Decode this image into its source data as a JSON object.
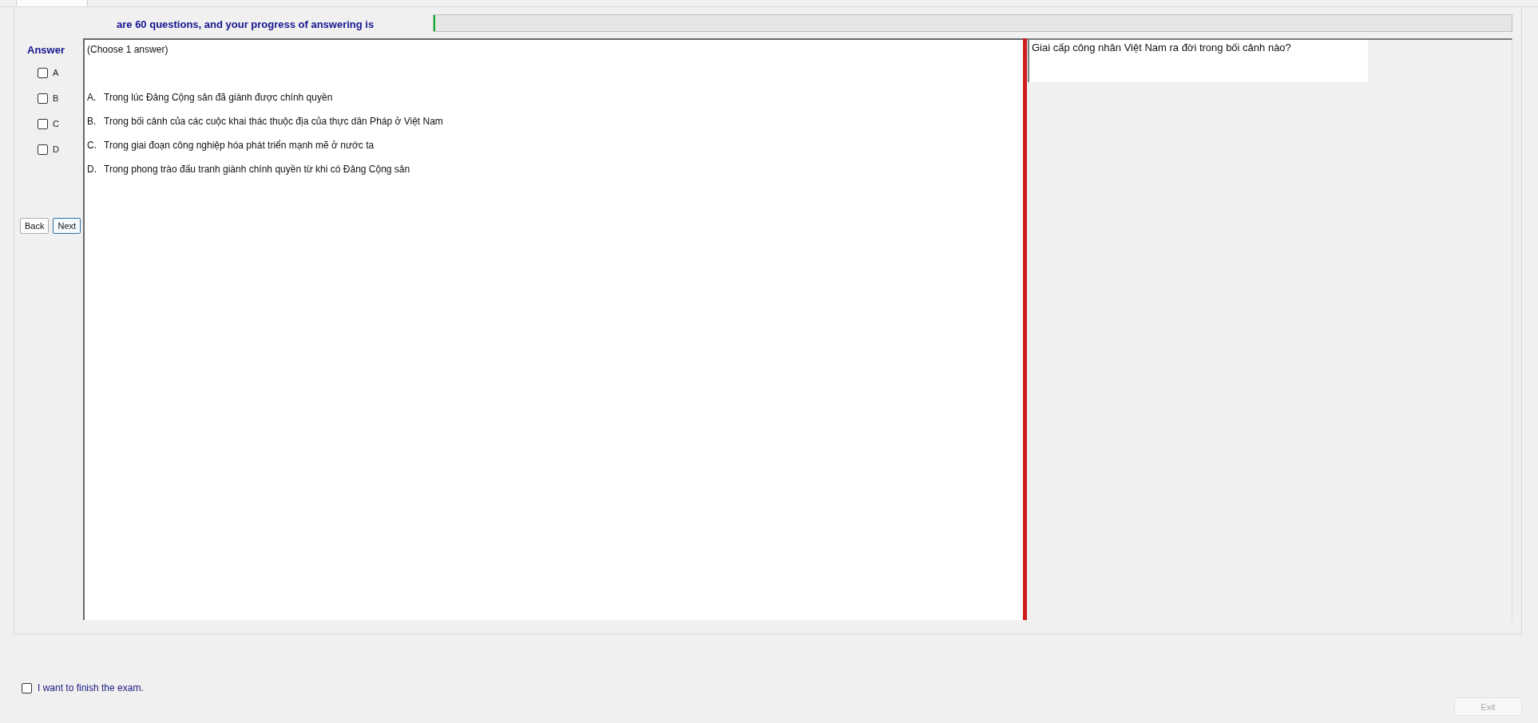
{
  "header": {
    "progress_text": "are 60 questions, and your progress of answering is",
    "progress": {
      "level": 0
    }
  },
  "answer_panel": {
    "title": "Answer",
    "options": [
      {
        "label": "A",
        "checked": false
      },
      {
        "label": "B",
        "checked": false
      },
      {
        "label": "C",
        "checked": false
      },
      {
        "label": "D",
        "checked": false
      }
    ],
    "buttons": [
      {
        "label": "Back",
        "focused": false
      },
      {
        "label": "Next",
        "focused": true
      }
    ]
  },
  "question_panel": {
    "instruction": "(Choose 1 answer)",
    "choices": [
      {
        "letter": "A.",
        "text": "Trong lúc Đảng Cộng sản đã giành được chính quyền"
      },
      {
        "letter": "B.",
        "text": "Trong bối cảnh của các cuộc khai thác thuộc địa của thực dân Pháp ở Việt Nam"
      },
      {
        "letter": "C.",
        "text": "Trong giai đoạn công nghiệp hóa phát triển mạnh mẽ ở nước ta"
      },
      {
        "letter": "D.",
        "text": "Trong phong trào đấu tranh giành chính quyền từ khi có Đảng Cộng sản"
      }
    ]
  },
  "question_box": {
    "text": "Giai cấp công nhân Việt Nam ra đời trong bối cảnh nào?"
  },
  "footer": {
    "finish_checkbox": {
      "label": "I want to finish the exam.",
      "checked": false
    },
    "exit_button": {
      "label": "Exit",
      "disabled": true
    }
  }
}
